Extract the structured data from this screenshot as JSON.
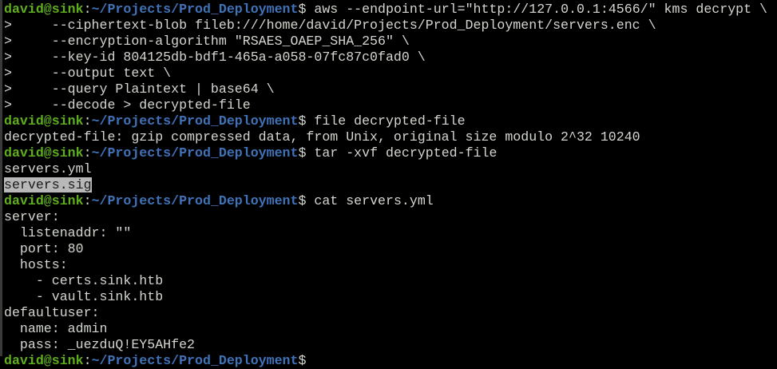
{
  "prompt": {
    "user_host": "david@sink",
    "sep": ":",
    "path": "~/Projects/Prod_Deployment",
    "symbol": "$ "
  },
  "lines": [
    {
      "type": "prompt",
      "text": "aws --endpoint-url=\"http://127.0.0.1:4566/\" kms decrypt \\"
    },
    {
      "type": "out",
      "text": ">     --ciphertext-blob fileb:///home/david/Projects/Prod_Deployment/servers.enc \\"
    },
    {
      "type": "out",
      "text": ">     --encryption-algorithm \"RSAES_OAEP_SHA_256\" \\"
    },
    {
      "type": "out",
      "text": ">     --key-id 804125db-bdf1-465a-a058-07fc87c0fad0 \\"
    },
    {
      "type": "out",
      "text": ">     --output text \\"
    },
    {
      "type": "out",
      "text": ">     --query Plaintext | base64 \\"
    },
    {
      "type": "out",
      "text": ">     --decode > decrypted-file"
    },
    {
      "type": "prompt",
      "text": "file decrypted-file"
    },
    {
      "type": "out",
      "text": "decrypted-file: gzip compressed data, from Unix, original size modulo 2^32 10240"
    },
    {
      "type": "prompt",
      "text": "tar -xvf decrypted-file"
    },
    {
      "type": "out",
      "text": "servers.yml"
    },
    {
      "type": "hl",
      "text": "servers.sig"
    },
    {
      "type": "prompt",
      "text": "cat servers.yml"
    },
    {
      "type": "out",
      "text": "server:"
    },
    {
      "type": "out",
      "text": "  listenaddr: \"\""
    },
    {
      "type": "out",
      "text": "  port: 80"
    },
    {
      "type": "out",
      "text": "  hosts:"
    },
    {
      "type": "out",
      "text": "    - certs.sink.htb"
    },
    {
      "type": "out",
      "text": "    - vault.sink.htb"
    },
    {
      "type": "out",
      "text": "defaultuser:"
    },
    {
      "type": "out",
      "text": "  name: admin"
    },
    {
      "type": "out",
      "text": "  pass: _uezduQ!EY5AHfe2"
    },
    {
      "type": "prompt",
      "text": ""
    }
  ]
}
